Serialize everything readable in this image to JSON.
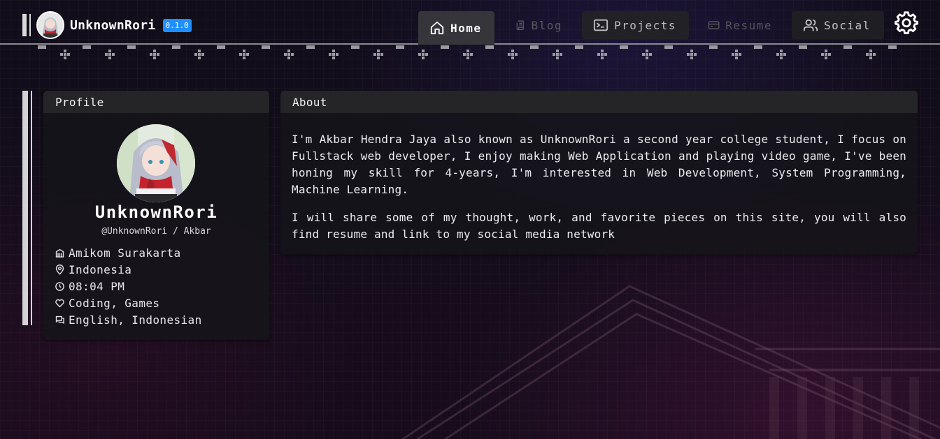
{
  "brand": {
    "title": "UnknownRori",
    "version": "0.1.0"
  },
  "nav": {
    "home": "Home",
    "blog": "Blog",
    "projects": "Projects",
    "resume": "Resume",
    "social": "Social"
  },
  "icons": {
    "home": "home-icon",
    "blog": "scroll-icon",
    "projects": "terminal-icon",
    "resume": "card-icon",
    "social": "users-icon",
    "settings": "gear-icon"
  },
  "colors": {
    "accent": "#1f8fff",
    "active_tab": "#35353a"
  },
  "profile": {
    "header": "Profile",
    "name": "UnknownRori",
    "handle": "@UnknownRori / Akbar",
    "info": {
      "school": "Amikom Surakarta",
      "location": "Indonesia",
      "time": "08:04 PM",
      "hobbies": "Coding, Games",
      "languages": "English, Indonesian"
    }
  },
  "about": {
    "header": "About",
    "paragraphs": [
      "I'm Akbar Hendra Jaya also known as UnknownRori a second year college student, I focus on Fullstack web developer, I enjoy making Web Application and playing video game, I've been honing my skill for 4-years, I'm interested in Web Development, System Programming, Machine Learning.",
      "I will share some of my thought, work, and favorite pieces on this site, you will also find resume and link to my social media network"
    ]
  }
}
